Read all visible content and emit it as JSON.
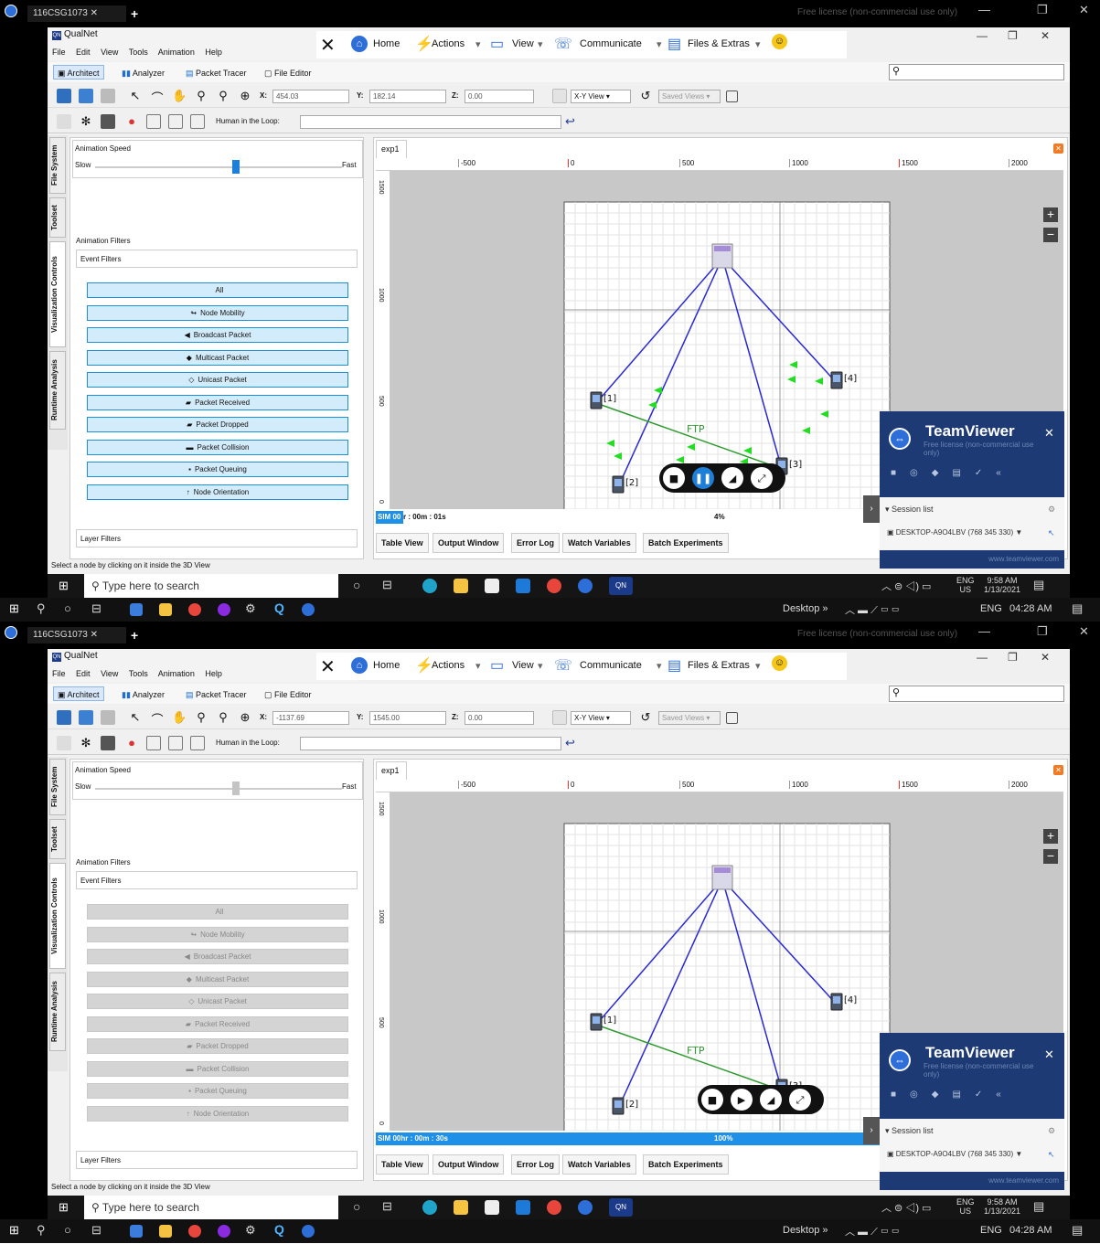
{
  "teamviewer_top": {
    "tab_label": "116CSG1073",
    "license_banner": "Free license (non-commercial use only)"
  },
  "app": {
    "title": "QualNet",
    "menus": [
      "File",
      "Edit",
      "View",
      "Tools",
      "Animation",
      "Help"
    ],
    "modes": [
      "Architect",
      "Analyzer",
      "Packet Tracer",
      "File Editor"
    ]
  },
  "teamviewer_bar": {
    "home": "Home",
    "actions": "Actions",
    "view": "View",
    "communicate": "Communicate",
    "files": "Files & Extras"
  },
  "toolbar": {
    "x_label": "X:",
    "y_label": "Y:",
    "z_label": "Z:",
    "view_select": "X-Y View",
    "saved_views": "Saved Views",
    "hitl_label": "Human in the Loop:"
  },
  "side_tabs": [
    "File System",
    "Toolset",
    "Visualization Controls",
    "Runtime Analysis"
  ],
  "panel": {
    "anim_speed": "Animation Speed",
    "slow": "Slow",
    "fast": "Fast",
    "anim_filters": "Animation Filters",
    "event_filters": "Event Filters",
    "layer_filters": "Layer Filters",
    "filters": [
      "All",
      "Node Mobility",
      "Broadcast Packet",
      "Multicast Packet",
      "Unicast Packet",
      "Packet Received",
      "Packet Dropped",
      "Packet Collision",
      "Packet Queuing",
      "Node Orientation"
    ],
    "filter_icons": [
      "",
      "↬",
      "◀",
      "◆",
      "◇",
      "▰",
      "▰",
      "▬",
      "▪",
      "↑"
    ]
  },
  "status_line": "Select a node by clicking on it inside the 3D View",
  "canvas": {
    "tab": "exp1",
    "ruler_ticks": [
      "-500",
      "0",
      "500",
      "1000",
      "1500",
      "2000"
    ],
    "vruler_ticks": [
      "1500",
      "1000",
      "500",
      "0"
    ],
    "nodes": [
      "[1]",
      "[2]",
      "[3]",
      "[4]"
    ],
    "link_label": "FTP"
  },
  "bottom_tabs": [
    "Table View",
    "Output Window",
    "Error Log",
    "Watch Variables",
    "Batch Experiments"
  ],
  "teamviewer_panel": {
    "brand": "TeamViewer",
    "license": "Free license (non-commercial use only)",
    "session_list": "Session list",
    "session_entry": "DESKTOP-A9O4LBV (768 345 330)",
    "link": "www.teamviewer.com"
  },
  "remote_taskbar": {
    "search": "Type here to search",
    "lang_top": "ENG",
    "lang_bottom": "US",
    "time": "9:58 AM",
    "date": "1/13/2021"
  },
  "host_taskbar": {
    "desktop": "Desktop",
    "lang": "ENG",
    "time": "04:28 AM"
  },
  "frames": [
    {
      "x": "454.03",
      "y": "182.14",
      "z": "0.00",
      "sim_label": "SIM 00",
      "sim_time": "r : 00m : 01s",
      "percent": "4%",
      "progress": 0.04,
      "playing": true,
      "filters_active": true
    },
    {
      "x": "-1137.69",
      "y": "1545.00",
      "z": "0.00",
      "sim_label": "SIM 00hr : 00m : 30s",
      "sim_time": "",
      "percent": "100%",
      "progress": 1.0,
      "playing": false,
      "filters_active": false
    }
  ],
  "colors": {
    "link_wireless": "#2929d8",
    "link_ftp": "#2f9a2f",
    "packet": "#22dd22",
    "progress": "#1e90e8",
    "teamviewer": "#1d3a74"
  }
}
